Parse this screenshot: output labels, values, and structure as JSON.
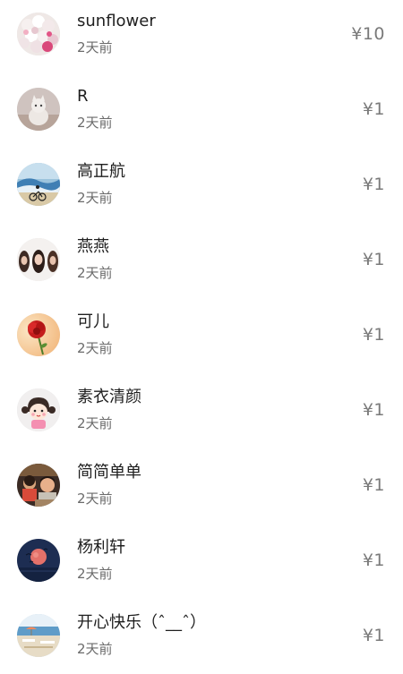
{
  "donations": [
    {
      "name": "sunflower",
      "time": "2天前",
      "amount": "¥10",
      "avatar_icon": "flower-bouquet-avatar-icon"
    },
    {
      "name": "R",
      "time": "2天前",
      "amount": "¥1",
      "avatar_icon": "cat-avatar-icon"
    },
    {
      "name": "高正航",
      "time": "2天前",
      "amount": "¥1",
      "avatar_icon": "sea-cyclist-avatar-icon"
    },
    {
      "name": "燕燕",
      "time": "2天前",
      "amount": "¥1",
      "avatar_icon": "group-photo-avatar-icon"
    },
    {
      "name": "可儿",
      "time": "2天前",
      "amount": "¥1",
      "avatar_icon": "red-rose-avatar-icon"
    },
    {
      "name": "素衣清颜",
      "time": "2天前",
      "amount": "¥1",
      "avatar_icon": "cartoon-girl-avatar-icon"
    },
    {
      "name": "简简单单",
      "time": "2天前",
      "amount": "¥1",
      "avatar_icon": "child-photo-avatar-icon"
    },
    {
      "name": "杨利轩",
      "time": "2天前",
      "amount": "¥1",
      "avatar_icon": "moon-night-avatar-icon"
    },
    {
      "name": "开心快乐（ˆ__ˆ）",
      "time": "2天前",
      "amount": "¥1",
      "avatar_icon": "beach-avatar-icon"
    }
  ]
}
